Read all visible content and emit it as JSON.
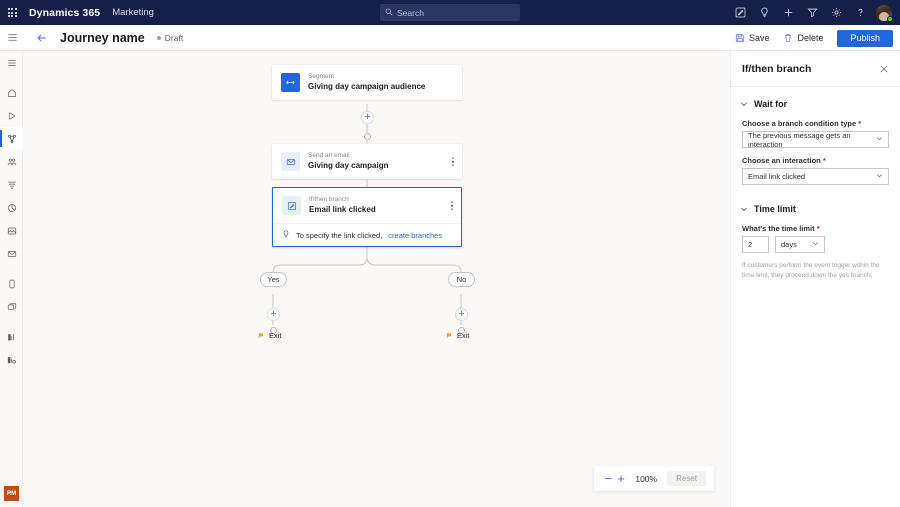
{
  "topnav": {
    "waffle_icon": "waffle-grid-icon",
    "brand": "Dynamics 365",
    "app": "Marketing",
    "search": {
      "placeholder": "Search",
      "value": "",
      "icon": "search-icon"
    },
    "icons": [
      {
        "name": "edit-pencil-icon",
        "title": "Edit"
      },
      {
        "name": "lightbulb-icon",
        "title": "Insights"
      },
      {
        "name": "plus-icon",
        "title": "New"
      },
      {
        "name": "filter-icon",
        "title": "Filter"
      },
      {
        "name": "gear-icon",
        "title": "Settings"
      },
      {
        "name": "help-question-icon",
        "title": "Help"
      }
    ],
    "avatar": {
      "name": "user-avatar",
      "presence": "available",
      "presence_color": "#5fd000"
    }
  },
  "commandbar": {
    "hamburger_icon": "hamburger-menu-icon",
    "back_icon": "back-arrow-icon",
    "title": "Journey name",
    "status": "Draft",
    "save_label": "Save",
    "save_icon": "save-disk-icon",
    "delete_label": "Delete",
    "delete_icon": "trash-icon",
    "publish_label": "Publish",
    "publish_color": "#2266dd"
  },
  "rail": {
    "items": [
      {
        "name": "hamburger",
        "icon": "hamburger-menu-icon",
        "selected": false
      },
      {
        "name": "home",
        "icon": "home-icon",
        "selected": false
      },
      {
        "name": "recent",
        "icon": "play-triangle-icon",
        "selected": false
      },
      {
        "name": "journeys",
        "icon": "journey-nodes-icon",
        "selected": true
      },
      {
        "name": "customers",
        "icon": "people-group-icon",
        "selected": false
      },
      {
        "name": "segments",
        "icon": "segment-filter-icon",
        "selected": false
      },
      {
        "name": "analytics",
        "icon": "pie-chart-icon",
        "selected": false
      },
      {
        "name": "forms",
        "icon": "form-image-icon",
        "selected": false
      },
      {
        "name": "emails",
        "icon": "envelope-icon",
        "selected": false
      },
      {
        "name": "mobile",
        "icon": "phone-icon",
        "selected": false
      },
      {
        "name": "push",
        "icon": "window-icon",
        "selected": false
      },
      {
        "name": "reports",
        "icon": "bar-chart-icon",
        "selected": false
      },
      {
        "name": "settings-reports",
        "icon": "bar-chart-gear-icon",
        "selected": false
      }
    ],
    "account_badge": "RM",
    "account_badge_color": "#c44d17"
  },
  "canvas": {
    "nodes": [
      {
        "id": "segment",
        "type": "Segment",
        "title": "Giving day campaign audience",
        "icon": "segment-icon",
        "icon_bg": "#2266dd",
        "icon_fg": "#ffffff",
        "selected": false,
        "has_more": false
      },
      {
        "id": "send-email",
        "type": "Send an email",
        "title": "Giving day campaign",
        "icon": "envelope-icon",
        "icon_bg": "#e8edfb",
        "icon_fg": "#4f6bed",
        "selected": false,
        "has_more": true
      },
      {
        "id": "ifthen",
        "type": "If/then branch",
        "title": "Email link clicked",
        "icon": "branch-edit-icon",
        "icon_bg": "#e4f3ee",
        "icon_fg": "#4f6bed",
        "selected": true,
        "has_more": true,
        "tip_icon": "lightbulb-icon",
        "tip_text": "To specify the link clicked,",
        "tip_link": "create branches"
      }
    ],
    "branches": [
      {
        "label": "Yes",
        "exit_label": "Exit"
      },
      {
        "label": "No",
        "exit_label": "Exit"
      }
    ],
    "add_icon": "plus-icon",
    "zoom": {
      "minus_label": "−",
      "plus_label": "+",
      "level": "100%",
      "reset_label": "Reset"
    }
  },
  "panel": {
    "title": "If/then branch",
    "close_icon": "close-icon",
    "sections": [
      {
        "name": "wait-for",
        "label": "Wait for",
        "chevron": "chevron-down-icon",
        "fields": [
          {
            "name": "branch-condition-type",
            "label": "Choose a branch condition type",
            "required": true,
            "value": "The previous message gets an interaction",
            "control": "dropdown"
          },
          {
            "name": "interaction",
            "label": "Choose an interaction",
            "required": true,
            "value": "Email link clicked",
            "control": "dropdown"
          }
        ]
      },
      {
        "name": "time-limit",
        "label": "Time limit",
        "chevron": "chevron-down-icon",
        "fields": [
          {
            "name": "time-limit-amount",
            "label": "What's the time limit",
            "required": true,
            "value": "2",
            "unit": "days",
            "control": "number-with-unit"
          }
        ],
        "help": "If customers perform the event trigger within the time limit, they proceed down the yes branch."
      }
    ]
  }
}
